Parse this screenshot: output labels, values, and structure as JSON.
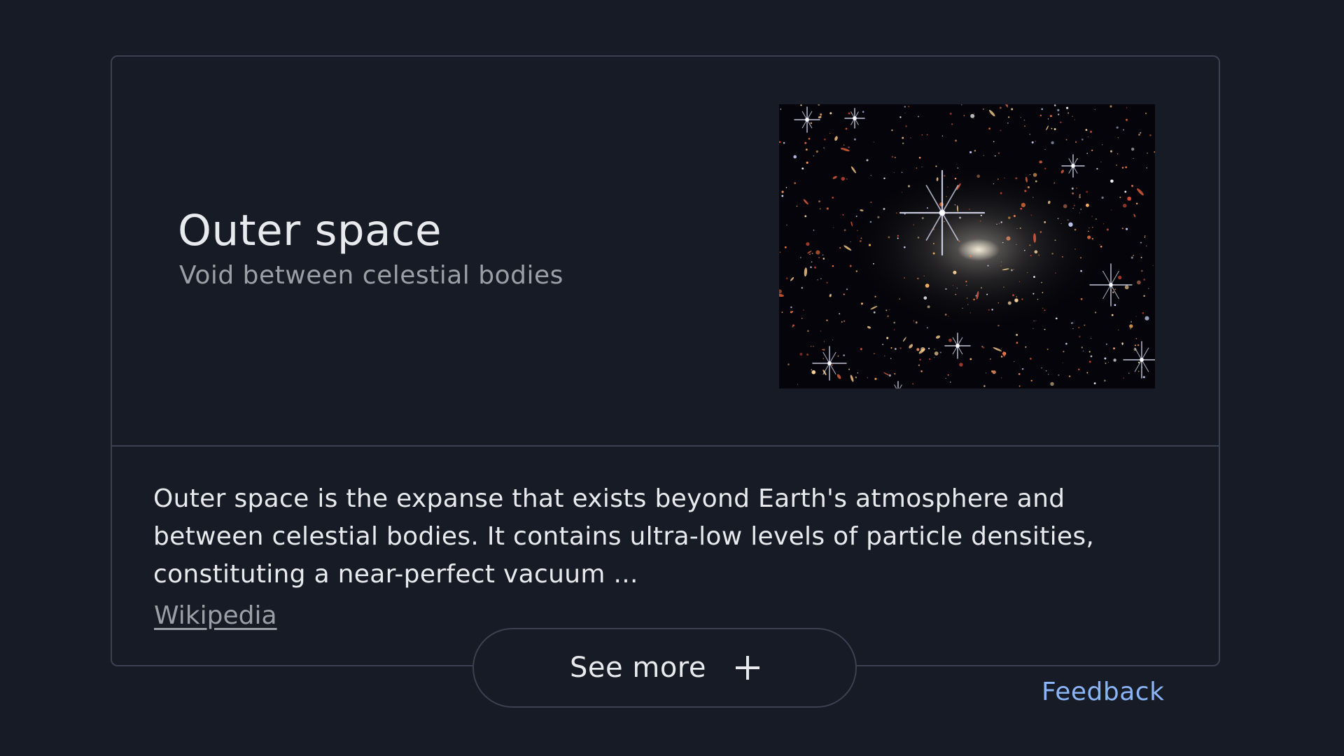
{
  "panel": {
    "title": "Outer space",
    "subtitle": "Void between celestial bodies",
    "image_alt": "Deep field image of space with many galaxies and stars",
    "description": "Outer space is the expanse that exists beyond Earth's atmosphere and between celestial bodies. It contains ultra-low levels of particle densities, constituting a near-perfect vacuum ...",
    "source_label": "Wikipedia",
    "see_more_label": "See more",
    "see_more_icon": "plus-icon",
    "feedback_label": "Feedback"
  },
  "colors": {
    "background": "#171b25",
    "border": "#3b4150",
    "text_primary": "#e8eaed",
    "text_secondary": "#9aa0a6",
    "link": "#8ab4f8"
  }
}
